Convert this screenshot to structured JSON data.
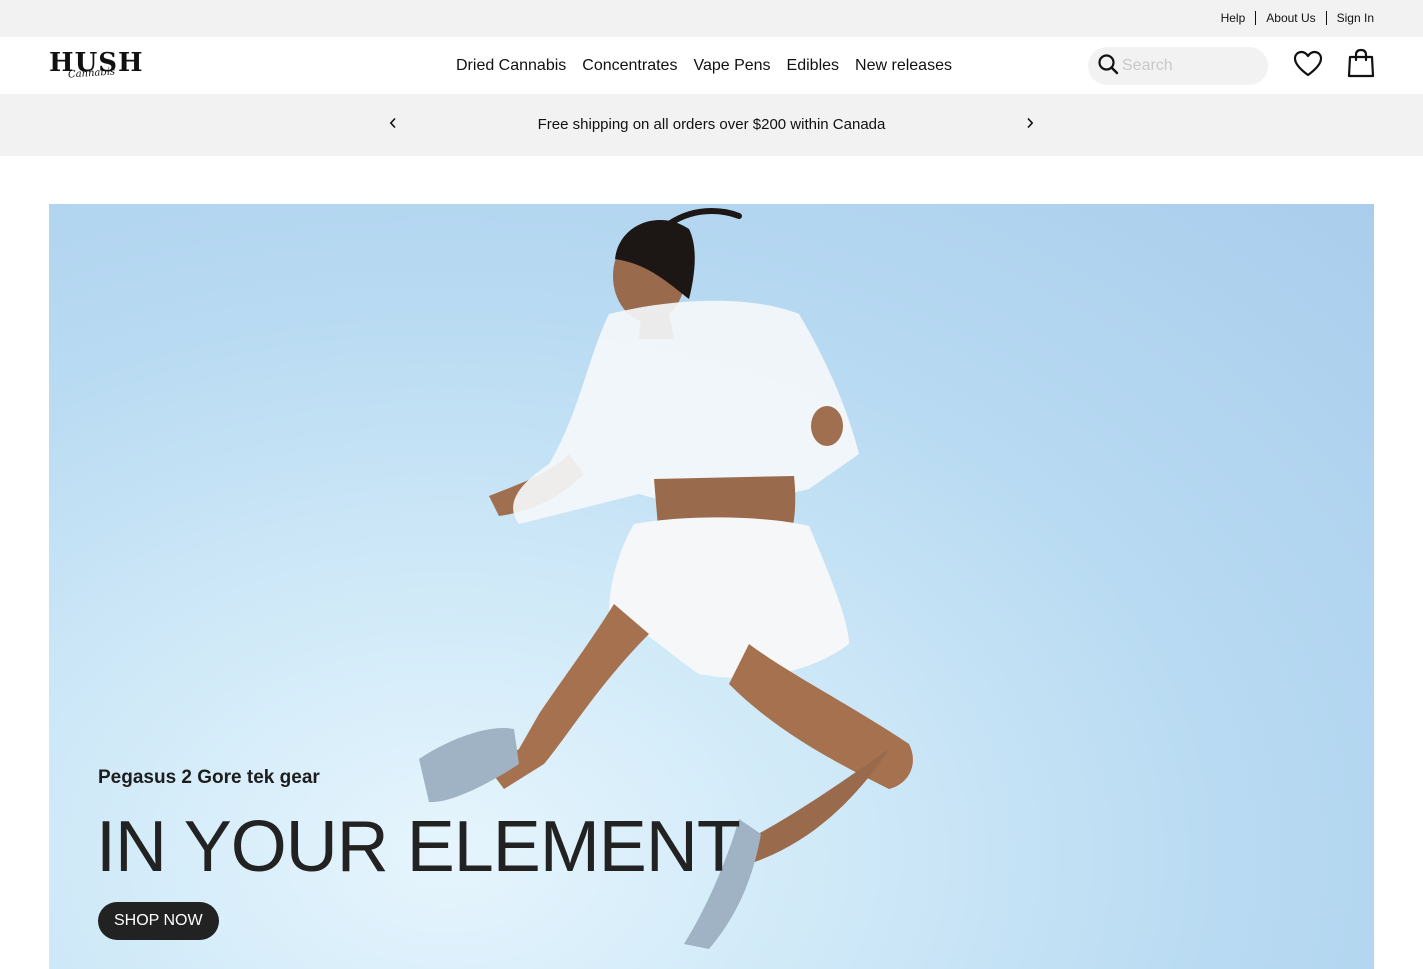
{
  "utility": {
    "links": [
      "Help",
      "About Us",
      "Sign In"
    ]
  },
  "brand": {
    "name": "HUSH",
    "tagline": "Cannabis"
  },
  "nav": {
    "items": [
      "Dried Cannabis",
      "Concentrates",
      "Vape Pens",
      "Edibles",
      "New releases"
    ]
  },
  "search": {
    "placeholder": "Search",
    "icon": "search-icon"
  },
  "header_icons": {
    "favorites": "heart-icon",
    "cart": "shopping-bag-icon"
  },
  "promo": {
    "text": "Free shipping on all orders over $200 within Canada",
    "prev_icon": "chevron-left-icon",
    "next_icon": "chevron-right-icon"
  },
  "hero": {
    "subtitle": "Pegasus 2 Gore tek gear",
    "title": "IN YOUR ELEMENT",
    "cta": "SHOP NOW"
  },
  "colors": {
    "bar_background": "#f2f2f2",
    "text": "#111111",
    "cta_background": "#222222",
    "hero_sky": "#b8daf2"
  }
}
